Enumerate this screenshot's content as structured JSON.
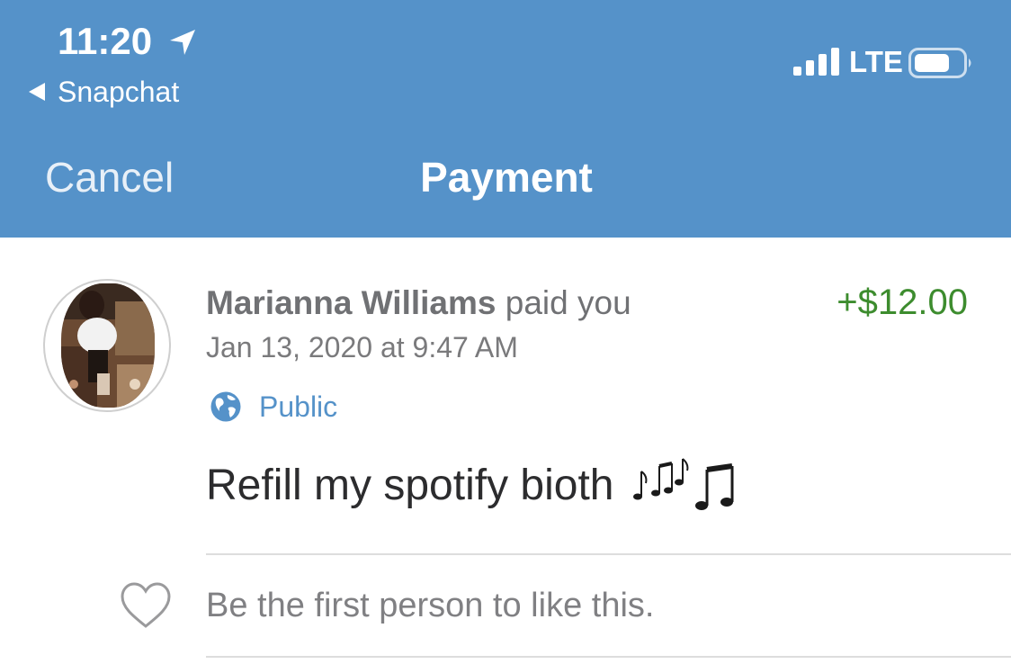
{
  "status_bar": {
    "time": "11:20",
    "back_app": "Snapchat",
    "carrier": "LTE",
    "icons": [
      "location-arrow-icon",
      "signal-bars-icon",
      "battery-icon"
    ]
  },
  "nav": {
    "cancel_label": "Cancel",
    "title": "Payment"
  },
  "transaction": {
    "sender": "Marianna Williams",
    "action": "paid you",
    "amount": "+$12.00",
    "datetime": "Jan 13, 2020 at 9:47 AM",
    "privacy": "Public",
    "message": "Refill my spotify bioth"
  },
  "likes": {
    "text": "Be the first person to like this."
  },
  "colors": {
    "header": "#5592C9",
    "accent": "#5592C9",
    "amount": "#3D8C2E",
    "text_secondary": "#707174"
  }
}
